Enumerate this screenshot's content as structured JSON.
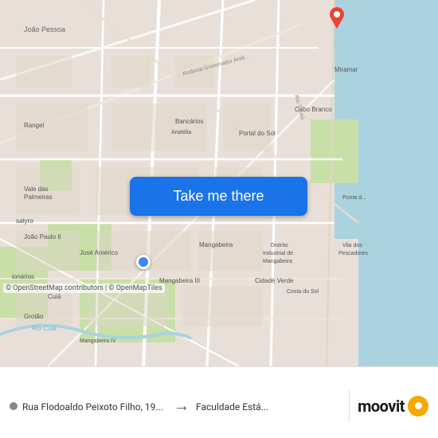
{
  "map": {
    "take_me_there_label": "Take me there",
    "attribution": "© OpenStreetMap contributors | © OpenMapTiles",
    "marker_blue_alt": "Start location",
    "marker_red_alt": "Destination"
  },
  "bottom_bar": {
    "from_label": "Rua Flodoaldo Peixoto Filho, 19...",
    "arrow": "→",
    "to_label": "Faculdade Está...",
    "brand_name": "moovit"
  },
  "colors": {
    "button_bg": "#1a73e8",
    "button_text": "#ffffff",
    "marker_blue": "#4285f4",
    "marker_red": "#ea4335",
    "moovit_orange": "#f7a800"
  }
}
